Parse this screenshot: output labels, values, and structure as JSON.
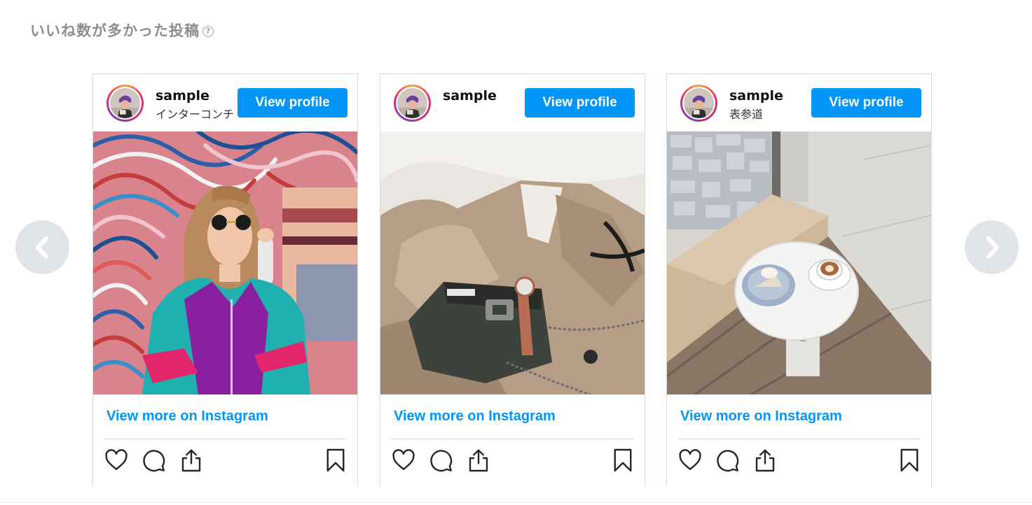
{
  "section": {
    "title": "いいね数が多かった投稿",
    "help_icon": "question-circle-icon",
    "help_glyph": "?"
  },
  "nav": {
    "prev_icon": "chevron-left-icon",
    "next_icon": "chevron-right-icon"
  },
  "posts": [
    {
      "username": "sample",
      "location": "インターコンチ",
      "view_profile_label": "View profile",
      "view_more_label": "View more on Instagram",
      "image": "woman-sunglasses-colorful-mural-photo"
    },
    {
      "username": "sample",
      "location": "",
      "view_profile_label": "View profile",
      "view_more_label": "View more on Instagram",
      "image": "beige-coat-handbag-watch-photo"
    },
    {
      "username": "sample",
      "location": "表参道",
      "view_profile_label": "View profile",
      "view_more_label": "View more on Instagram",
      "image": "cafe-table-cake-latte-photo"
    }
  ],
  "actions": {
    "like_icon": "heart-icon",
    "comment_icon": "comment-icon",
    "share_icon": "share-icon",
    "save_icon": "bookmark-icon"
  },
  "colors": {
    "accent": "#0095f6",
    "title": "#8e8e8e",
    "nav_bg": "#e1e5ea",
    "border": "#dbdbdb"
  }
}
